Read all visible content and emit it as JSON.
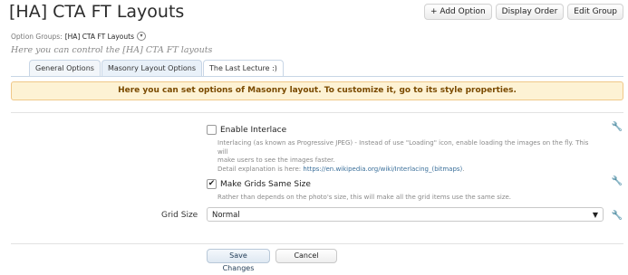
{
  "header": {
    "title": "[HA] CTA FT Layouts",
    "buttons": [
      "+ Add Option",
      "Display Order",
      "Edit Group"
    ]
  },
  "option_groups": {
    "label": "Option Groups:",
    "value": "[HA] CTA FT Layouts"
  },
  "description": "Here you can control the [HA] CTA FT layouts",
  "tabs": [
    "General Options",
    "Masonry Layout Options",
    "The Last Lecture :)"
  ],
  "active_tab": "Masonry Layout Options",
  "notice": "Here you can set options of Masonry layout. To customize it, go to its style properties.",
  "options": {
    "interlace": {
      "label": "Enable Interlace",
      "checked": false,
      "explain_1": "Interlacing (as known as Progressive JPEG) - Instead of use \"Loading\" icon, enable loading the images on the fly. This will",
      "explain_2": "make users to see the images faster.",
      "explain_3_prefix": "Detail explanation is here: ",
      "explain_3_link": "https://en.wikipedia.org/wiki/Interlacing_(bitmaps)",
      "explain_3_suffix": "."
    },
    "same_size": {
      "label": "Make Grids Same Size",
      "checked": true,
      "explain": "Rather than depends on the photo's size, this will make all the grid items use the same size."
    },
    "grid_size": {
      "label": "Grid Size",
      "value": "Normal"
    }
  },
  "footer": {
    "save": "Save Changes",
    "cancel": "Cancel"
  },
  "colors": {
    "notice_bg": "#fdf2d4",
    "notice_text": "#7a4a00",
    "link": "#3a6f9a"
  }
}
